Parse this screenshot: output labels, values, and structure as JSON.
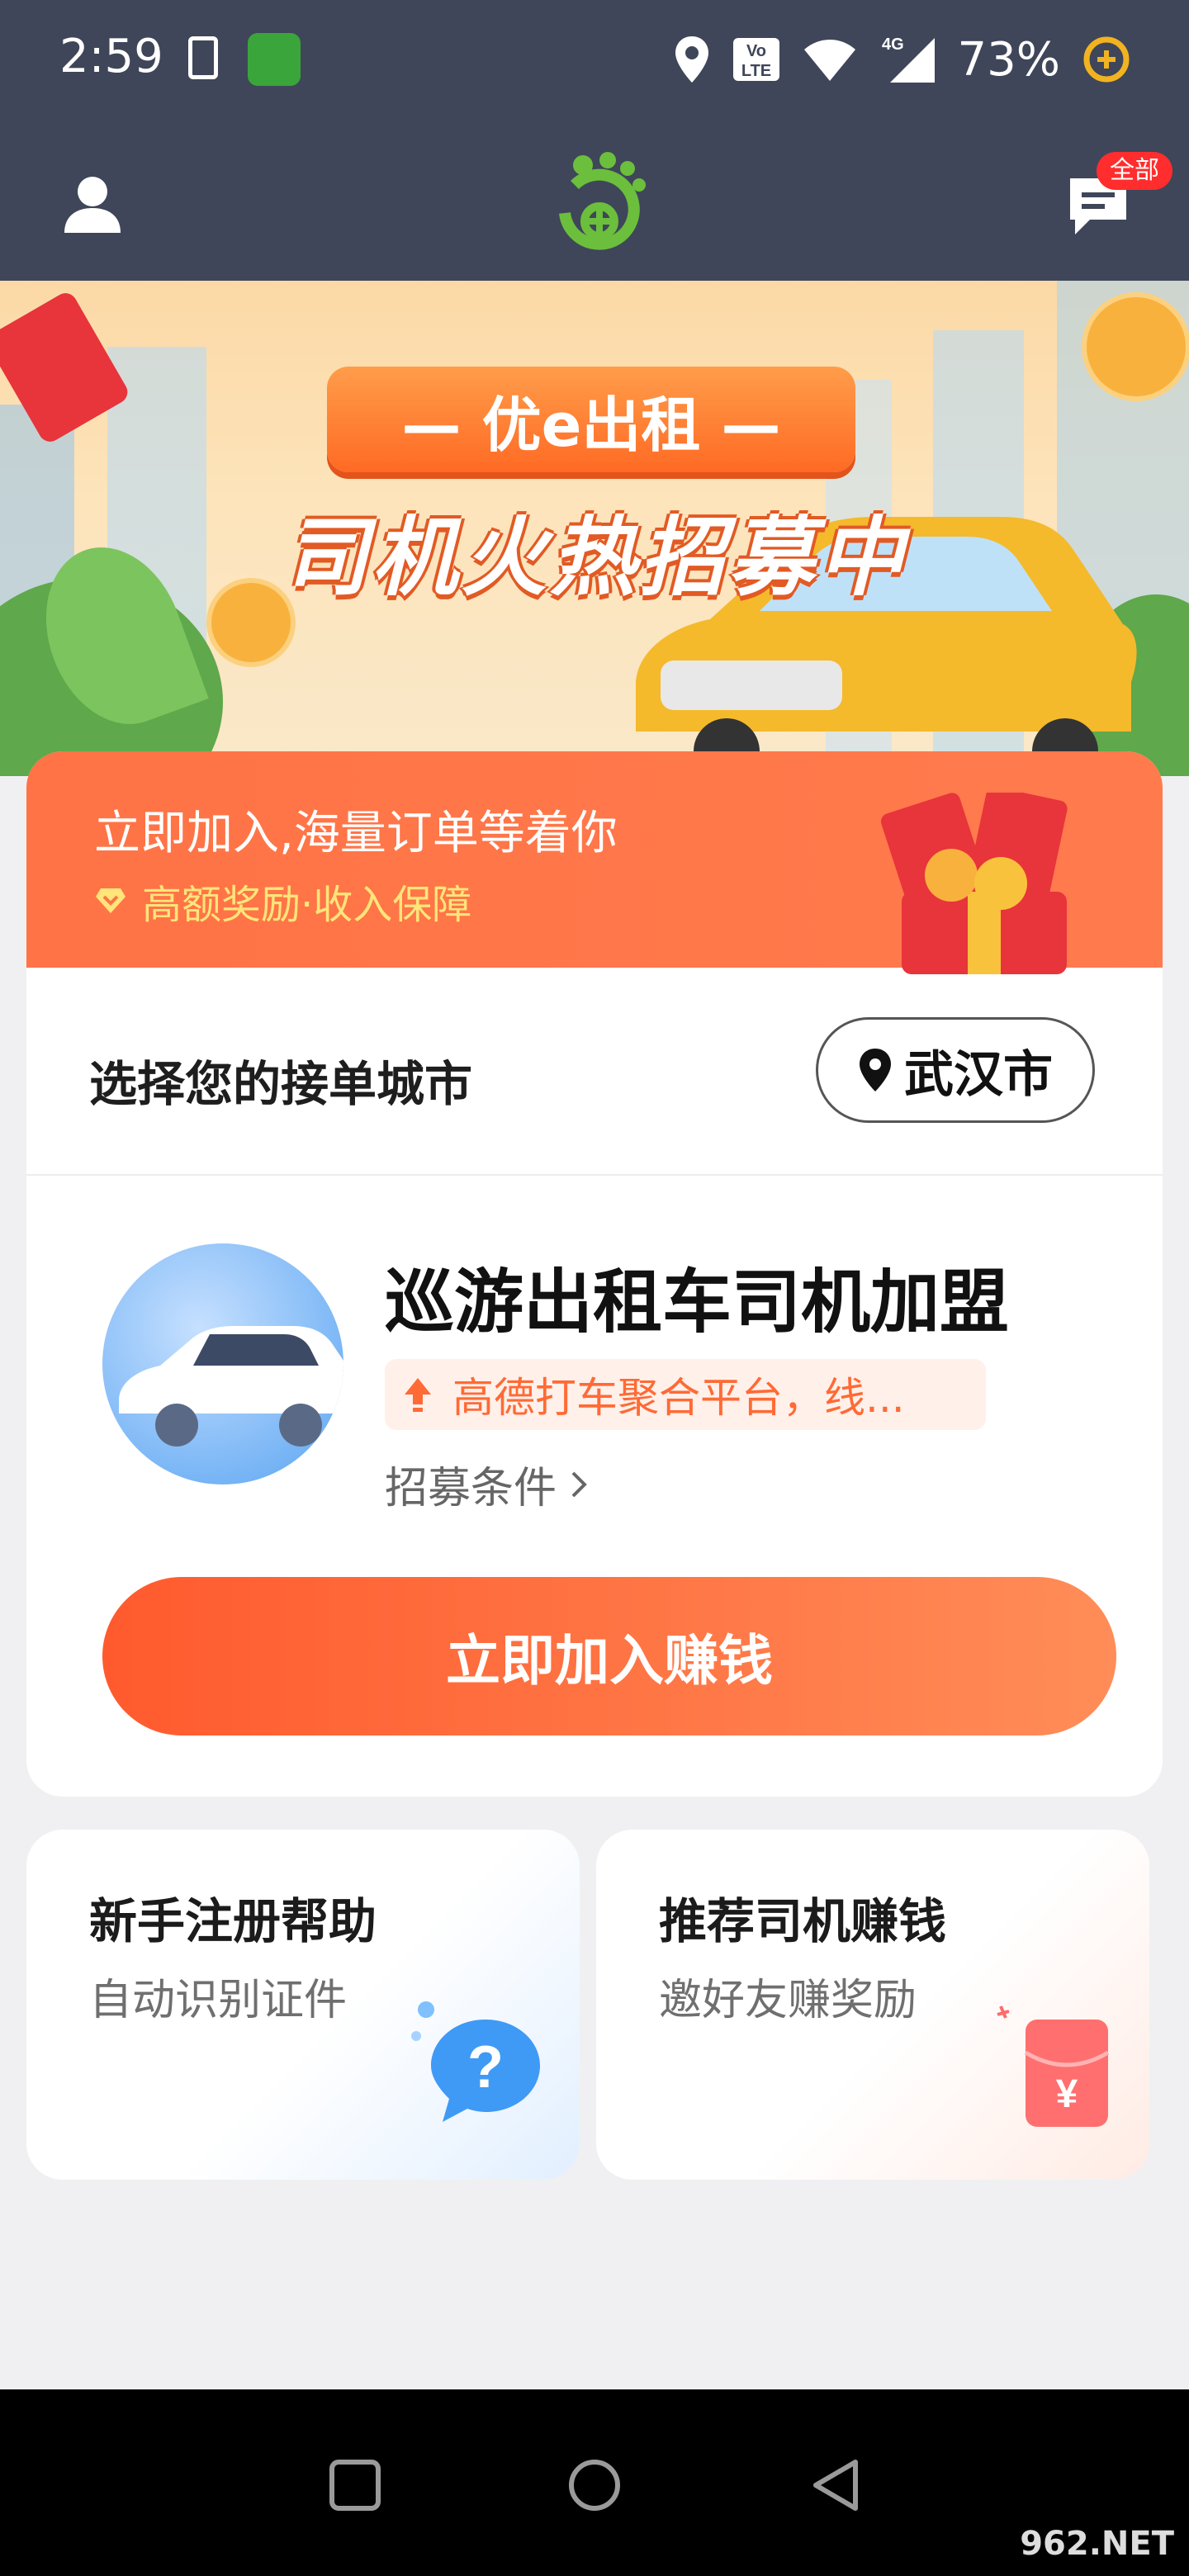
{
  "status_bar": {
    "time": "2:59",
    "battery": "73%",
    "network": "4G",
    "volte": "Vo LTE"
  },
  "header": {
    "message_badge": "全部"
  },
  "banner": {
    "brand": "— 优e出租 —",
    "headline": "司机火热招募中"
  },
  "join_card": {
    "headline": "立即加入,海量订单等着你",
    "subline": "高额奖励·收入保障",
    "city_label": "选择您的接单城市",
    "city_value": "武汉市",
    "service_title": "巡游出租车司机加盟",
    "service_tag": "高德打车聚合平台，线...",
    "recruit_link": "招募条件",
    "join_button": "立即加入赚钱"
  },
  "help_card": {
    "title": "新手注册帮助",
    "subtitle": "自动识别证件"
  },
  "refer_card": {
    "title": "推荐司机赚钱",
    "subtitle": "邀好友赚奖励"
  },
  "watermark": "962.NET",
  "colors": {
    "header_bg": "#3f4659",
    "accent_orange": "#ff6a35",
    "tag_bg": "#fff0ea",
    "page_bg": "#f0f0f2"
  }
}
